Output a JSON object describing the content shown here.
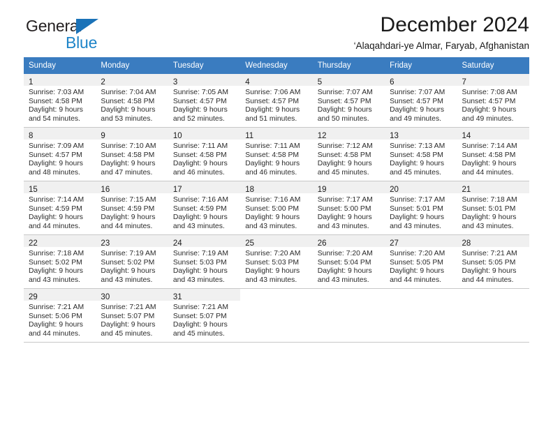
{
  "brand": {
    "name_part1": "General",
    "name_part2": "Blue",
    "accent_color": "#1d84c8",
    "triangle_color": "#1a72b8"
  },
  "header": {
    "title": "December 2024",
    "subtitle": "‘Alaqahdari-ye Almar, Faryab, Afghanistan"
  },
  "calendar": {
    "header_bg": "#3a7cc0",
    "daynum_band_bg": "#f0f0f0",
    "weekday_names": [
      "Sunday",
      "Monday",
      "Tuesday",
      "Wednesday",
      "Thursday",
      "Friday",
      "Saturday"
    ],
    "weeks": [
      [
        {
          "day": "1",
          "sunrise": "Sunrise: 7:03 AM",
          "sunset": "Sunset: 4:58 PM",
          "daylight_line1": "Daylight: 9 hours",
          "daylight_line2": "and 54 minutes."
        },
        {
          "day": "2",
          "sunrise": "Sunrise: 7:04 AM",
          "sunset": "Sunset: 4:58 PM",
          "daylight_line1": "Daylight: 9 hours",
          "daylight_line2": "and 53 minutes."
        },
        {
          "day": "3",
          "sunrise": "Sunrise: 7:05 AM",
          "sunset": "Sunset: 4:57 PM",
          "daylight_line1": "Daylight: 9 hours",
          "daylight_line2": "and 52 minutes."
        },
        {
          "day": "4",
          "sunrise": "Sunrise: 7:06 AM",
          "sunset": "Sunset: 4:57 PM",
          "daylight_line1": "Daylight: 9 hours",
          "daylight_line2": "and 51 minutes."
        },
        {
          "day": "5",
          "sunrise": "Sunrise: 7:07 AM",
          "sunset": "Sunset: 4:57 PM",
          "daylight_line1": "Daylight: 9 hours",
          "daylight_line2": "and 50 minutes."
        },
        {
          "day": "6",
          "sunrise": "Sunrise: 7:07 AM",
          "sunset": "Sunset: 4:57 PM",
          "daylight_line1": "Daylight: 9 hours",
          "daylight_line2": "and 49 minutes."
        },
        {
          "day": "7",
          "sunrise": "Sunrise: 7:08 AM",
          "sunset": "Sunset: 4:57 PM",
          "daylight_line1": "Daylight: 9 hours",
          "daylight_line2": "and 49 minutes."
        }
      ],
      [
        {
          "day": "8",
          "sunrise": "Sunrise: 7:09 AM",
          "sunset": "Sunset: 4:57 PM",
          "daylight_line1": "Daylight: 9 hours",
          "daylight_line2": "and 48 minutes."
        },
        {
          "day": "9",
          "sunrise": "Sunrise: 7:10 AM",
          "sunset": "Sunset: 4:58 PM",
          "daylight_line1": "Daylight: 9 hours",
          "daylight_line2": "and 47 minutes."
        },
        {
          "day": "10",
          "sunrise": "Sunrise: 7:11 AM",
          "sunset": "Sunset: 4:58 PM",
          "daylight_line1": "Daylight: 9 hours",
          "daylight_line2": "and 46 minutes."
        },
        {
          "day": "11",
          "sunrise": "Sunrise: 7:11 AM",
          "sunset": "Sunset: 4:58 PM",
          "daylight_line1": "Daylight: 9 hours",
          "daylight_line2": "and 46 minutes."
        },
        {
          "day": "12",
          "sunrise": "Sunrise: 7:12 AM",
          "sunset": "Sunset: 4:58 PM",
          "daylight_line1": "Daylight: 9 hours",
          "daylight_line2": "and 45 minutes."
        },
        {
          "day": "13",
          "sunrise": "Sunrise: 7:13 AM",
          "sunset": "Sunset: 4:58 PM",
          "daylight_line1": "Daylight: 9 hours",
          "daylight_line2": "and 45 minutes."
        },
        {
          "day": "14",
          "sunrise": "Sunrise: 7:14 AM",
          "sunset": "Sunset: 4:58 PM",
          "daylight_line1": "Daylight: 9 hours",
          "daylight_line2": "and 44 minutes."
        }
      ],
      [
        {
          "day": "15",
          "sunrise": "Sunrise: 7:14 AM",
          "sunset": "Sunset: 4:59 PM",
          "daylight_line1": "Daylight: 9 hours",
          "daylight_line2": "and 44 minutes."
        },
        {
          "day": "16",
          "sunrise": "Sunrise: 7:15 AM",
          "sunset": "Sunset: 4:59 PM",
          "daylight_line1": "Daylight: 9 hours",
          "daylight_line2": "and 44 minutes."
        },
        {
          "day": "17",
          "sunrise": "Sunrise: 7:16 AM",
          "sunset": "Sunset: 4:59 PM",
          "daylight_line1": "Daylight: 9 hours",
          "daylight_line2": "and 43 minutes."
        },
        {
          "day": "18",
          "sunrise": "Sunrise: 7:16 AM",
          "sunset": "Sunset: 5:00 PM",
          "daylight_line1": "Daylight: 9 hours",
          "daylight_line2": "and 43 minutes."
        },
        {
          "day": "19",
          "sunrise": "Sunrise: 7:17 AM",
          "sunset": "Sunset: 5:00 PM",
          "daylight_line1": "Daylight: 9 hours",
          "daylight_line2": "and 43 minutes."
        },
        {
          "day": "20",
          "sunrise": "Sunrise: 7:17 AM",
          "sunset": "Sunset: 5:01 PM",
          "daylight_line1": "Daylight: 9 hours",
          "daylight_line2": "and 43 minutes."
        },
        {
          "day": "21",
          "sunrise": "Sunrise: 7:18 AM",
          "sunset": "Sunset: 5:01 PM",
          "daylight_line1": "Daylight: 9 hours",
          "daylight_line2": "and 43 minutes."
        }
      ],
      [
        {
          "day": "22",
          "sunrise": "Sunrise: 7:18 AM",
          "sunset": "Sunset: 5:02 PM",
          "daylight_line1": "Daylight: 9 hours",
          "daylight_line2": "and 43 minutes."
        },
        {
          "day": "23",
          "sunrise": "Sunrise: 7:19 AM",
          "sunset": "Sunset: 5:02 PM",
          "daylight_line1": "Daylight: 9 hours",
          "daylight_line2": "and 43 minutes."
        },
        {
          "day": "24",
          "sunrise": "Sunrise: 7:19 AM",
          "sunset": "Sunset: 5:03 PM",
          "daylight_line1": "Daylight: 9 hours",
          "daylight_line2": "and 43 minutes."
        },
        {
          "day": "25",
          "sunrise": "Sunrise: 7:20 AM",
          "sunset": "Sunset: 5:03 PM",
          "daylight_line1": "Daylight: 9 hours",
          "daylight_line2": "and 43 minutes."
        },
        {
          "day": "26",
          "sunrise": "Sunrise: 7:20 AM",
          "sunset": "Sunset: 5:04 PM",
          "daylight_line1": "Daylight: 9 hours",
          "daylight_line2": "and 43 minutes."
        },
        {
          "day": "27",
          "sunrise": "Sunrise: 7:20 AM",
          "sunset": "Sunset: 5:05 PM",
          "daylight_line1": "Daylight: 9 hours",
          "daylight_line2": "and 44 minutes."
        },
        {
          "day": "28",
          "sunrise": "Sunrise: 7:21 AM",
          "sunset": "Sunset: 5:05 PM",
          "daylight_line1": "Daylight: 9 hours",
          "daylight_line2": "and 44 minutes."
        }
      ],
      [
        {
          "day": "29",
          "sunrise": "Sunrise: 7:21 AM",
          "sunset": "Sunset: 5:06 PM",
          "daylight_line1": "Daylight: 9 hours",
          "daylight_line2": "and 44 minutes."
        },
        {
          "day": "30",
          "sunrise": "Sunrise: 7:21 AM",
          "sunset": "Sunset: 5:07 PM",
          "daylight_line1": "Daylight: 9 hours",
          "daylight_line2": "and 45 minutes."
        },
        {
          "day": "31",
          "sunrise": "Sunrise: 7:21 AM",
          "sunset": "Sunset: 5:07 PM",
          "daylight_line1": "Daylight: 9 hours",
          "daylight_line2": "and 45 minutes."
        },
        {
          "day": "",
          "sunrise": "",
          "sunset": "",
          "daylight_line1": "",
          "daylight_line2": ""
        },
        {
          "day": "",
          "sunrise": "",
          "sunset": "",
          "daylight_line1": "",
          "daylight_line2": ""
        },
        {
          "day": "",
          "sunrise": "",
          "sunset": "",
          "daylight_line1": "",
          "daylight_line2": ""
        },
        {
          "day": "",
          "sunrise": "",
          "sunset": "",
          "daylight_line1": "",
          "daylight_line2": ""
        }
      ]
    ]
  }
}
